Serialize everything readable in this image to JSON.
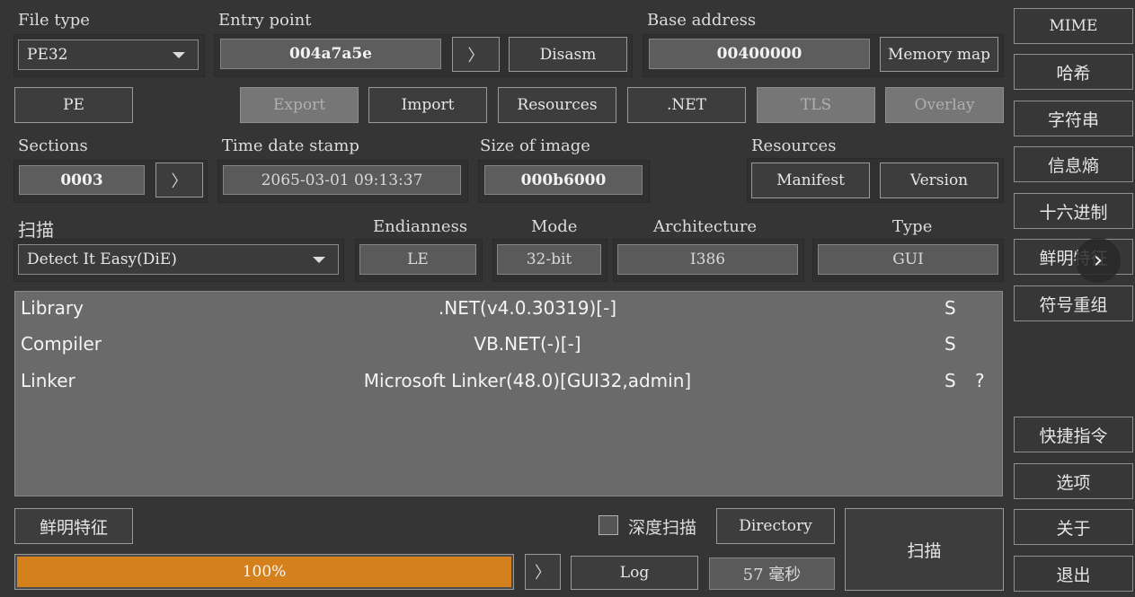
{
  "file_type": {
    "label": "File type",
    "value": "PE32"
  },
  "entry_point": {
    "label": "Entry point",
    "value": "004a7a5e",
    "go_icon": "chevron-right-icon",
    "disasm": "Disasm"
  },
  "base_address": {
    "label": "Base address",
    "value": "00400000",
    "memory_map": "Memory map"
  },
  "pe_button": "PE",
  "feature_buttons": {
    "export": "Export",
    "import": "Import",
    "resources": "Resources",
    "net": ".NET",
    "tls": "TLS",
    "overlay": "Overlay"
  },
  "sections": {
    "label": "Sections",
    "value": "0003"
  },
  "time_date_stamp": {
    "label": "Time date stamp",
    "value": "2065-03-01 09:13:37"
  },
  "size_of_image": {
    "label": "Size of image",
    "value": "000b6000"
  },
  "resources_group": {
    "label": "Resources",
    "manifest": "Manifest",
    "version": "Version"
  },
  "scan": {
    "label": "扫描",
    "engine": "Detect It Easy(DiE)"
  },
  "endianness": {
    "label": "Endianness",
    "value": "LE"
  },
  "mode": {
    "label": "Mode",
    "value": "32-bit"
  },
  "architecture": {
    "label": "Architecture",
    "value": "I386"
  },
  "type": {
    "label": "Type",
    "value": "GUI"
  },
  "results": [
    {
      "category": "Library",
      "name": ".NET(v4.0.30319)[-]",
      "flag": "S",
      "extra": ""
    },
    {
      "category": "Compiler",
      "name": "VB.NET(-)[-]",
      "flag": "S",
      "extra": ""
    },
    {
      "category": "Linker",
      "name": "Microsoft Linker(48.0)[GUI32,admin]",
      "flag": "S",
      "extra": "?"
    }
  ],
  "bottom": {
    "signatures_button": "鲜明特征",
    "deep_scan_label": "深度扫描",
    "directory_button": "Directory",
    "scan_button": "扫描",
    "progress": 1.0,
    "progress_text": "100%",
    "log_button": "Log",
    "elapsed": "57 毫秒"
  },
  "sidebar": {
    "items": [
      "MIME",
      "哈希",
      "字符串",
      "信息熵",
      "十六进制",
      "鲜明特征",
      "符号重组"
    ],
    "bottom_items": [
      "快捷指令",
      "选项",
      "关于",
      "退出"
    ]
  },
  "colors": {
    "progress_fill": "#d4801c",
    "background": "#353535",
    "results_bg": "#6a6a6a"
  }
}
